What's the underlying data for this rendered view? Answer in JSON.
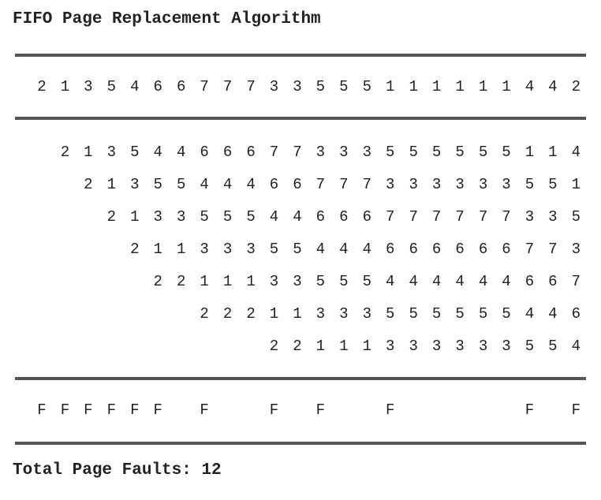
{
  "title": "FIFO Page Replacement Algorithm",
  "reference_string": [
    "2",
    "1",
    "3",
    "5",
    "4",
    "6",
    "6",
    "7",
    "7",
    "7",
    "3",
    "3",
    "5",
    "5",
    "5",
    "1",
    "1",
    "1",
    "1",
    "1",
    "1",
    "4",
    "4",
    "2"
  ],
  "frames": [
    [
      "",
      "2",
      "1",
      "3",
      "5",
      "4",
      "4",
      "6",
      "6",
      "6",
      "7",
      "7",
      "3",
      "3",
      "3",
      "5",
      "5",
      "5",
      "5",
      "5",
      "5",
      "1",
      "1",
      "4"
    ],
    [
      "",
      "",
      "2",
      "1",
      "3",
      "5",
      "5",
      "4",
      "4",
      "4",
      "6",
      "6",
      "7",
      "7",
      "7",
      "3",
      "3",
      "3",
      "3",
      "3",
      "3",
      "5",
      "5",
      "1"
    ],
    [
      "",
      "",
      "",
      "2",
      "1",
      "3",
      "3",
      "5",
      "5",
      "5",
      "4",
      "4",
      "6",
      "6",
      "6",
      "7",
      "7",
      "7",
      "7",
      "7",
      "7",
      "3",
      "3",
      "5"
    ],
    [
      "",
      "",
      "",
      "",
      "2",
      "1",
      "1",
      "3",
      "3",
      "3",
      "5",
      "5",
      "4",
      "4",
      "4",
      "6",
      "6",
      "6",
      "6",
      "6",
      "6",
      "7",
      "7",
      "3"
    ],
    [
      "",
      "",
      "",
      "",
      "",
      "2",
      "2",
      "1",
      "1",
      "1",
      "3",
      "3",
      "5",
      "5",
      "5",
      "4",
      "4",
      "4",
      "4",
      "4",
      "4",
      "6",
      "6",
      "7"
    ],
    [
      "",
      "",
      "",
      "",
      "",
      "",
      "",
      "2",
      "2",
      "2",
      "1",
      "1",
      "3",
      "3",
      "3",
      "5",
      "5",
      "5",
      "5",
      "5",
      "5",
      "4",
      "4",
      "6"
    ],
    [
      "",
      "",
      "",
      "",
      "",
      "",
      "",
      "",
      "",
      "",
      "2",
      "2",
      "1",
      "1",
      "1",
      "3",
      "3",
      "3",
      "3",
      "3",
      "3",
      "5",
      "5",
      "4"
    ]
  ],
  "faults": [
    "F",
    "F",
    "F",
    "F",
    "F",
    "F",
    "",
    "F",
    "",
    "",
    "F",
    "",
    "F",
    "",
    "",
    "F",
    "",
    "",
    "",
    "",
    "",
    "F",
    "",
    "F"
  ],
  "footer": "Total Page Faults: 12"
}
